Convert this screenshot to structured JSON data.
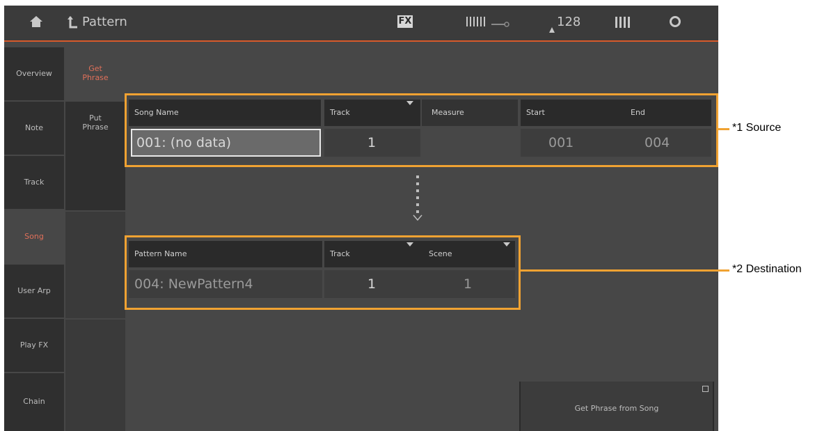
{
  "header": {
    "home_icon": "home-icon",
    "back_icon": "up-arrow-icon",
    "title": "Pattern",
    "fx_badge": "FX",
    "tempo": "128"
  },
  "sidebar": {
    "items": [
      {
        "label": "Overview"
      },
      {
        "label": "Note"
      },
      {
        "label": "Track"
      },
      {
        "label": "Song",
        "active": true
      },
      {
        "label": "User Arp"
      },
      {
        "label": "Play FX"
      },
      {
        "label": "Chain"
      }
    ]
  },
  "subnav": {
    "items": [
      {
        "label": "Get Phrase",
        "active": true
      },
      {
        "label": "Put Phrase"
      }
    ]
  },
  "source": {
    "headers": {
      "song_name": "Song Name",
      "track": "Track",
      "measure": "Measure",
      "start": "Start",
      "end": "End"
    },
    "values": {
      "song_name": "001: (no data)",
      "track": "1",
      "start": "001",
      "end": "004"
    }
  },
  "destination": {
    "headers": {
      "pattern_name": "Pattern Name",
      "track": "Track",
      "scene": "Scene"
    },
    "values": {
      "pattern_name": "004: NewPattern4",
      "track": "1",
      "scene": "1"
    }
  },
  "action_button": {
    "label": "Get Phrase from Song"
  },
  "callouts": {
    "source": "*1 Source",
    "destination": "*2 Destination"
  },
  "colors": {
    "accent": "#d75a2b",
    "highlight": "#f0a232",
    "active_text": "#e0705a"
  }
}
